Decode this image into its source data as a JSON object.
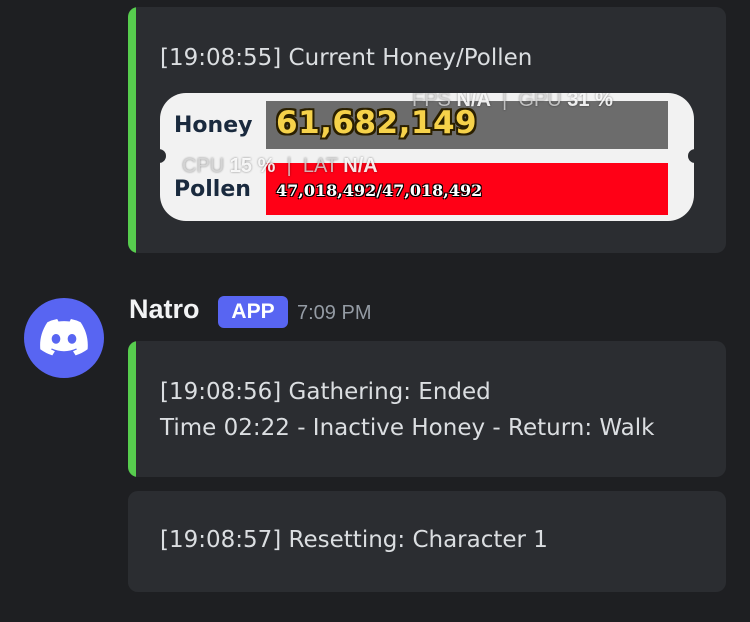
{
  "embeds": [
    {
      "line1": "[19:08:55] Current Honey/Pollen",
      "accent": "#57cc4e"
    },
    {
      "line1": "[19:08:56] Gathering: Ended",
      "line2": "Time 02:22 - Inactive Honey - Return: Walk",
      "accent": "#57cc4e"
    },
    {
      "line1": "[19:08:57] Resetting: Character 1"
    }
  ],
  "game_image": {
    "honey_label": "Honey",
    "honey_value": "61,682,149",
    "pollen_label": "Pollen",
    "pollen_value": "47,018,492/47,018,492",
    "pollen_fill_fraction": 1.0,
    "honey_color": "#f6d24a",
    "pollen_bar_color": "#ff0016",
    "overlay_top": {
      "fps_label": "FPS",
      "fps_value": "N/A",
      "sep": "|",
      "gpu_label": "GPU",
      "gpu_value": "31 %"
    },
    "overlay_bottom": {
      "cpu_label": "CPU",
      "cpu_value": "15 %",
      "sep": "|",
      "lat_label": "LAT",
      "lat_value": "N/A"
    }
  },
  "message": {
    "author": "Natro",
    "badge": "APP",
    "timestamp": "7:09 PM",
    "avatar_icon": "discord-logo-icon",
    "avatar_color": "#5865f2"
  }
}
